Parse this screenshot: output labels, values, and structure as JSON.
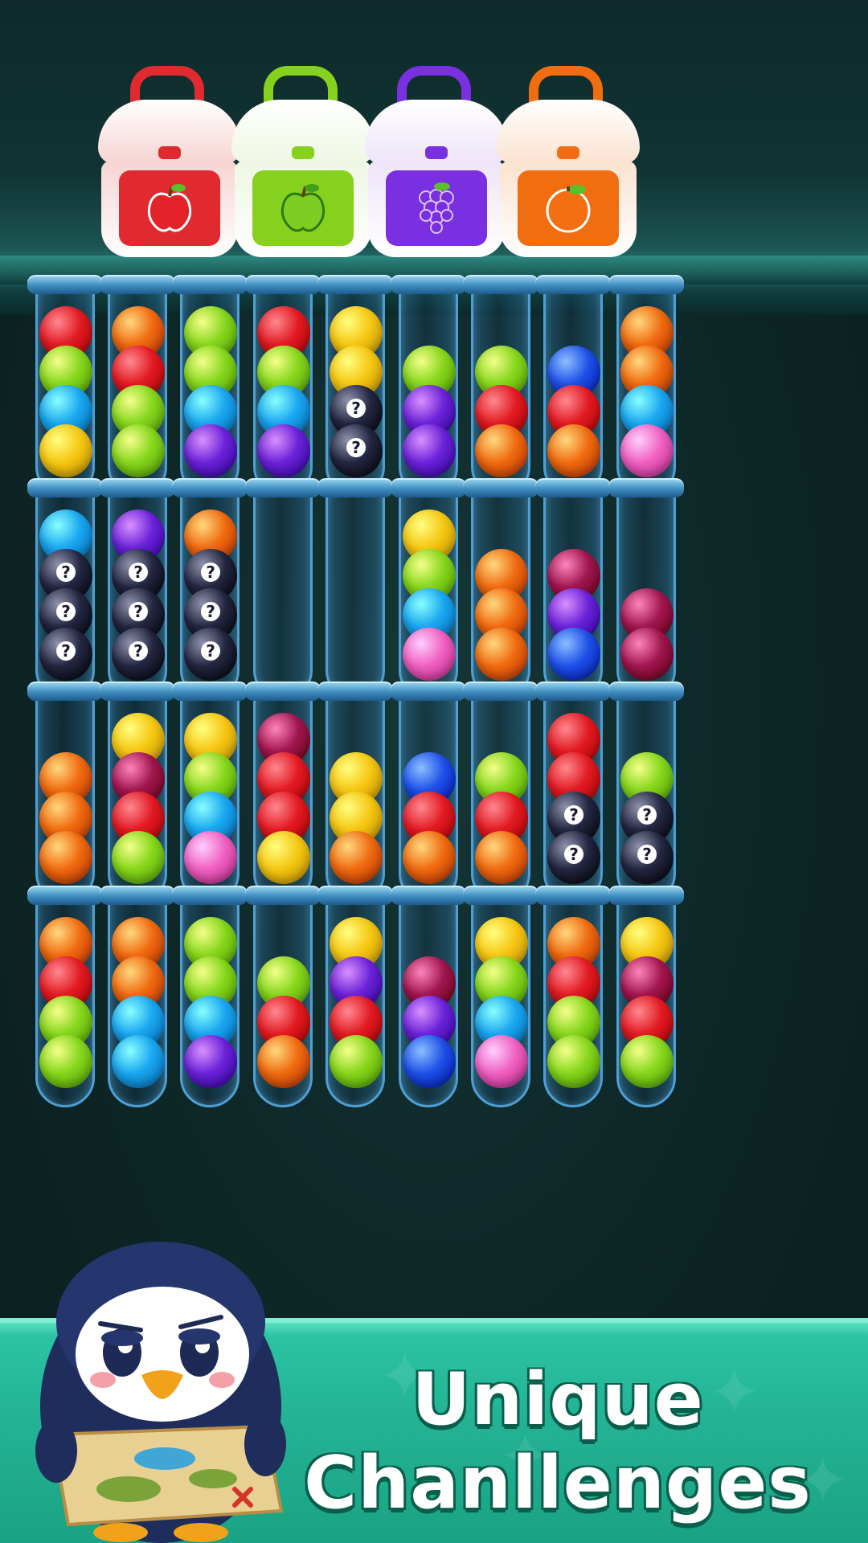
{
  "headline": {
    "line1": "Unique",
    "line2": "Chanllenges"
  },
  "colors": {
    "red": "#e21a22",
    "orange": "#f06a10",
    "yellow": "#f5c612",
    "lime": "#86d61c",
    "cyan": "#1aa6f0",
    "purple": "#6b22d8",
    "pink": "#f060c0",
    "blue": "#1e50e8",
    "magenta": "#a0164e",
    "mystery": "#232640"
  },
  "bags": [
    {
      "fruit": "apple-red-icon",
      "color": "#e02a30",
      "lid": "#f6d4d2"
    },
    {
      "fruit": "apple-green-icon",
      "color": "#86d11e",
      "lid": "#eef7e2"
    },
    {
      "fruit": "grapes-icon",
      "color": "#7a2fe0",
      "lid": "#eee4f8"
    },
    {
      "fruit": "orange-icon",
      "color": "#f06e10",
      "lid": "#fbe2cf"
    }
  ],
  "tubes": [
    [
      "red",
      "lime",
      "cyan",
      "yellow"
    ],
    [
      "orange",
      "red",
      "lime",
      "lime"
    ],
    [
      "lime",
      "lime",
      "cyan",
      "purple"
    ],
    [
      "red",
      "lime",
      "cyan",
      "purple"
    ],
    [
      "yellow",
      "yellow",
      "mystery",
      "mystery"
    ],
    [
      "lime",
      "purple",
      "purple"
    ],
    [
      "lime",
      "red",
      "orange"
    ],
    [
      "blue",
      "red",
      "orange"
    ],
    [
      "orange",
      "orange",
      "cyan",
      "pink"
    ],
    [
      "cyan",
      "mystery",
      "mystery",
      "mystery"
    ],
    [
      "purple",
      "mystery",
      "mystery",
      "mystery"
    ],
    [
      "orange",
      "mystery",
      "mystery",
      "mystery"
    ],
    [],
    [],
    [
      "yellow",
      "lime",
      "cyan",
      "pink"
    ],
    [
      "orange",
      "orange",
      "orange"
    ],
    [
      "magenta",
      "purple",
      "blue"
    ],
    [
      "magenta",
      "magenta"
    ],
    [
      "orange",
      "orange",
      "orange"
    ],
    [
      "yellow",
      "magenta",
      "red",
      "lime"
    ],
    [
      "yellow",
      "lime",
      "cyan",
      "pink"
    ],
    [
      "magenta",
      "red",
      "red",
      "yellow"
    ],
    [
      "yellow",
      "yellow",
      "orange"
    ],
    [
      "blue",
      "red",
      "orange"
    ],
    [
      "lime",
      "red",
      "orange"
    ],
    [
      "red",
      "red",
      "mystery",
      "mystery"
    ],
    [
      "lime",
      "mystery",
      "mystery"
    ],
    [
      "orange",
      "red",
      "lime",
      "lime"
    ],
    [
      "orange",
      "orange",
      "cyan",
      "cyan"
    ],
    [
      "lime",
      "lime",
      "cyan",
      "purple"
    ],
    [
      "lime",
      "red",
      "orange"
    ],
    [
      "yellow",
      "purple",
      "red",
      "lime"
    ],
    [
      "magenta",
      "purple",
      "blue"
    ],
    [
      "yellow",
      "lime",
      "cyan",
      "pink"
    ],
    [
      "orange",
      "red",
      "lime",
      "lime"
    ],
    [
      "yellow",
      "magenta",
      "red",
      "lime"
    ]
  ]
}
